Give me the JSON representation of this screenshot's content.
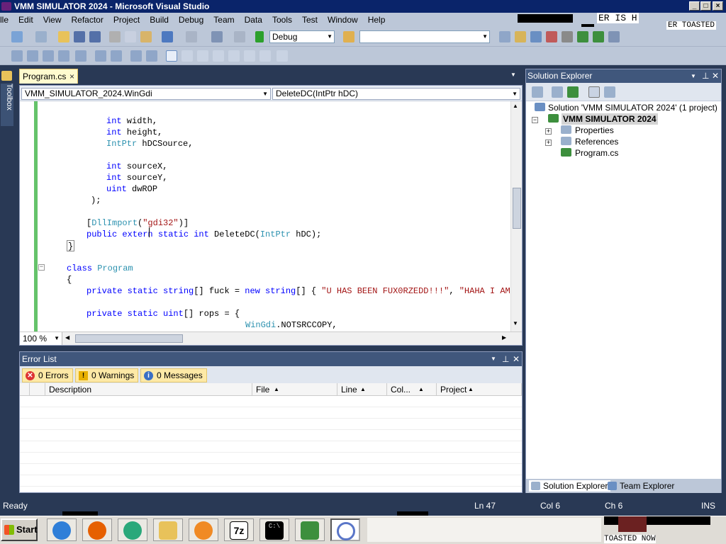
{
  "window": {
    "title": "VMM SIMULATOR 2024 - Microsoft Visual Studio",
    "controls": [
      "_",
      "□",
      "×"
    ]
  },
  "menu": [
    "lle",
    "Edit",
    "View",
    "Refactor",
    "Project",
    "Build",
    "Debug",
    "Team",
    "Data",
    "Tools",
    "Test",
    "Window",
    "Help"
  ],
  "toolbar": {
    "config": "Debug",
    "platform": ""
  },
  "glitch_text": {
    "line1": "ER IS H",
    "line2": "ER TOASTED",
    "line3": "TOASTED NOW"
  },
  "sidebar": {
    "toolbox_label": "Toolbox"
  },
  "document_tab": {
    "label": "Program.cs",
    "close": "×"
  },
  "navbar": {
    "type_selector": "VMM_SIMULATOR_2024.WinGdi",
    "member_selector": "DeleteDC(IntPtr hDC)"
  },
  "code": {
    "l1_a": "int",
    "l1_b": " width,",
    "l2_a": "int",
    "l2_b": " height,",
    "l3_a": "IntPtr",
    "l3_b": " hDCSource,",
    "l4_a": "int",
    "l4_b": " sourceX,",
    "l5_a": "int",
    "l5_b": " sourceY,",
    "l6_a": "uint",
    "l6_b": " dwROP",
    "l7": ");",
    "l8_a": "[",
    "l8_b": "DllImport",
    "l8_c": "(",
    "l8_d": "\"gdi32\"",
    "l8_e": ")]",
    "l9_a": "public extern static int",
    "l9_b": " DeleteDC(",
    "l9_c": "IntPtr",
    "l9_d": " hDC);",
    "l10": "}",
    "l11_a": "class",
    "l11_b": " Program",
    "l12": "{",
    "l13_a": "private static string",
    "l13_b": "[] fuck = ",
    "l13_c": "new string",
    "l13_d": "[] { ",
    "l13_e": "\"U HAS BEEN FUX0RZEDD!!!\"",
    "l13_f": ", ",
    "l13_g": "\"HAHA I AM CO",
    "l14_a": "private static uint",
    "l14_b": "[] rops = {",
    "l15_a": "WinGdi",
    "l15_b": ".NOTSRCCOPY,"
  },
  "editor": {
    "zoom": "100 %"
  },
  "error_list": {
    "title": "Error List",
    "errors": "0 Errors",
    "warnings": "0 Warnings",
    "messages": "0 Messages",
    "columns": [
      "Description",
      "File",
      "Line",
      "Col...",
      "Project"
    ]
  },
  "solution_explorer": {
    "title": "Solution Explorer",
    "solution": "Solution 'VMM SIMULATOR 2024' (1 project)",
    "project": "VMM SIMULATOR 2024",
    "items": [
      "Properties",
      "References",
      "Program.cs"
    ],
    "tabs": [
      "Solution Explorer",
      "Team Explorer"
    ]
  },
  "status": {
    "text": "Ready",
    "ln": "Ln 47",
    "col": "Col 6",
    "ch": "Ch 6",
    "mode": "INS"
  },
  "taskbar": {
    "start": "Start",
    "apps": [
      "ie-icon",
      "firefox-icon",
      "messenger-icon",
      "explorer-folder-icon",
      "media-player-icon",
      "7zip-icon",
      "cmd-icon",
      "taskmgr-icon",
      "visual-studio-icon"
    ],
    "seven_zip_label": "7z",
    "cmd_label": "C:\\"
  },
  "colors": {
    "accent": "#293955",
    "keyword": "#0000ff",
    "type": "#2b91af",
    "string": "#a31515"
  }
}
